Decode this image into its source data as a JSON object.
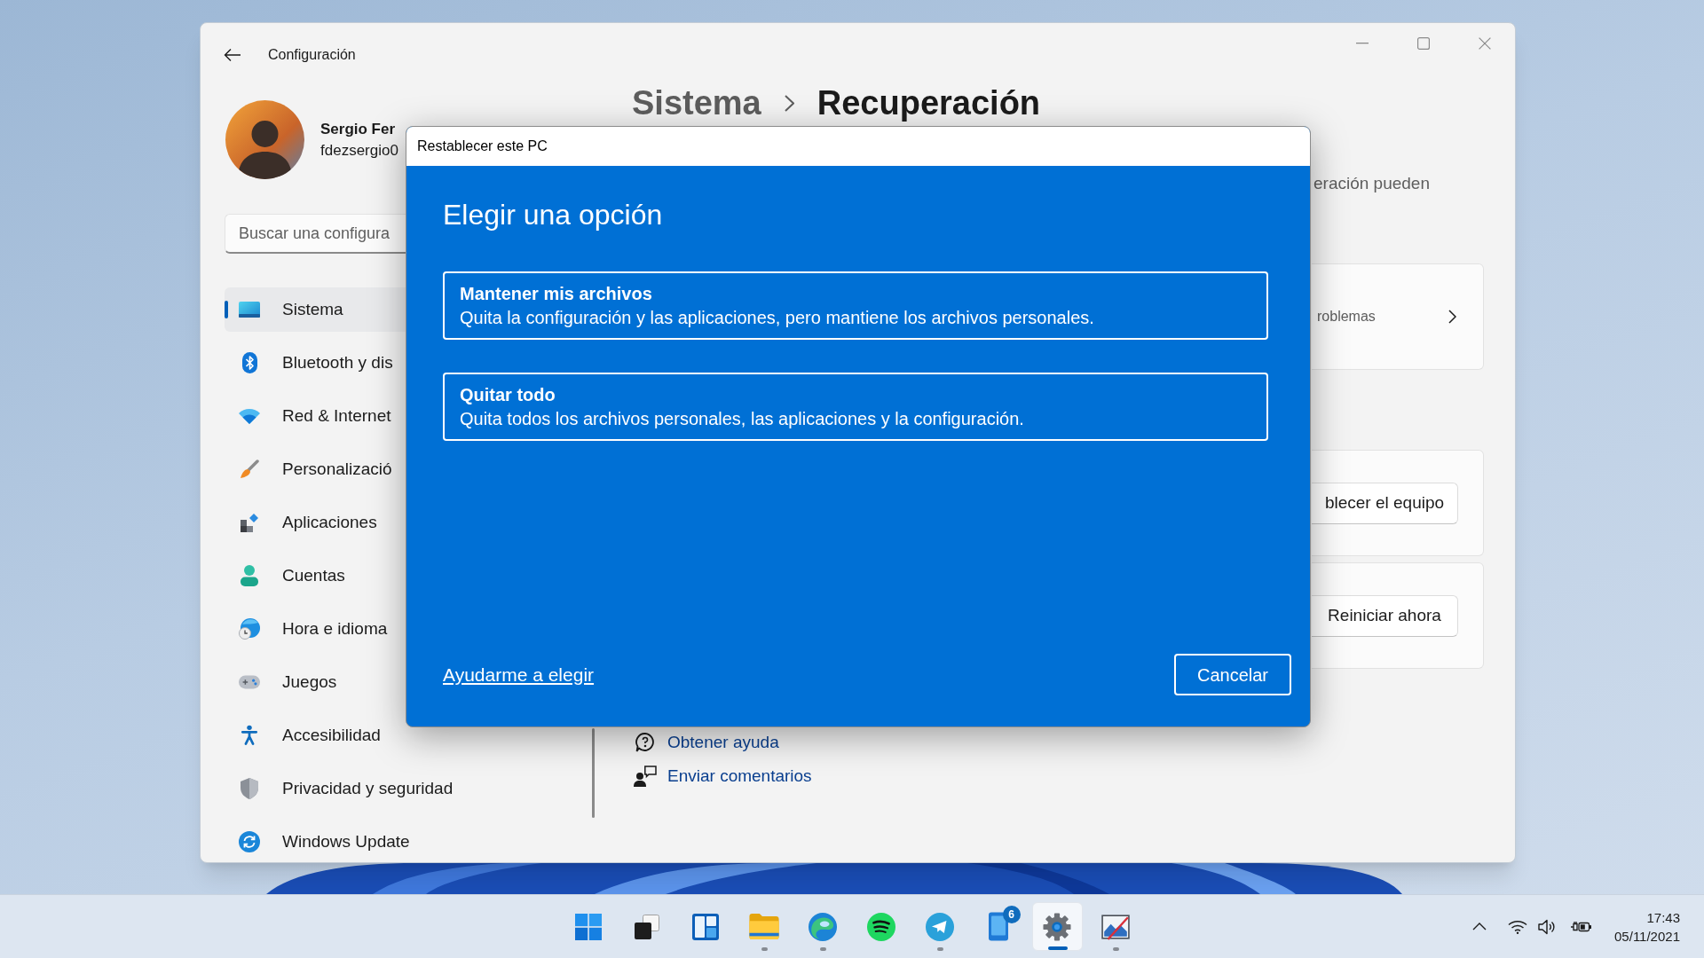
{
  "settings_window": {
    "title": "Configuración",
    "profile": {
      "name": "Sergio Fer",
      "email": "fdezsergio0"
    },
    "search": {
      "placeholder": "Buscar una configura"
    },
    "nav_items": [
      {
        "label": "Sistema",
        "selected": true
      },
      {
        "label": "Bluetooth y dis",
        "selected": false
      },
      {
        "label": "Red & Internet",
        "selected": false
      },
      {
        "label": "Personalizació",
        "selected": false
      },
      {
        "label": "Aplicaciones",
        "selected": false
      },
      {
        "label": "Cuentas",
        "selected": false
      },
      {
        "label": "Hora e idioma",
        "selected": false
      },
      {
        "label": "Juegos",
        "selected": false
      },
      {
        "label": "Accesibilidad",
        "selected": false
      },
      {
        "label": "Privacidad y seguridad",
        "selected": false
      },
      {
        "label": "Windows Update",
        "selected": false
      }
    ],
    "breadcrumb": [
      "Sistema",
      "Recuperación"
    ],
    "description": "eración pueden",
    "cards": [
      {
        "kind": "link",
        "text": "roblemas"
      },
      {
        "kind": "button",
        "text": "blecer el equipo"
      },
      {
        "kind": "button",
        "text": "Reiniciar ahora"
      }
    ],
    "help_links": [
      "Obtener ayuda",
      "Enviar comentarios"
    ]
  },
  "dialog": {
    "title": "Restablecer este PC",
    "heading": "Elegir una opción",
    "options": [
      {
        "title": "Mantener mis archivos",
        "description": "Quita la configuración y las aplicaciones, pero mantiene los archivos personales."
      },
      {
        "title": "Quitar todo",
        "description": "Quita todos los archivos personales, las aplicaciones y la configuración."
      }
    ],
    "link": "Ayudarme a elegir",
    "button": "Cancelar"
  },
  "taskbar": {
    "apps": [
      {
        "kind": "start",
        "running": false,
        "active": false
      },
      {
        "kind": "task_view",
        "running": false,
        "active": false
      },
      {
        "kind": "widgets",
        "running": false,
        "active": false
      },
      {
        "kind": "explorer",
        "running": true,
        "active": false
      },
      {
        "kind": "browser",
        "running": true,
        "active": false
      },
      {
        "kind": "music",
        "running": false,
        "active": false
      },
      {
        "kind": "messenger",
        "running": true,
        "active": false
      },
      {
        "kind": "phone",
        "running": false,
        "active": false,
        "badge": "6"
      },
      {
        "kind": "settings",
        "running": true,
        "active": true
      },
      {
        "kind": "image_editor",
        "running": true,
        "active": false
      }
    ],
    "clock": {
      "time": "17:43",
      "date": "05/11/2021"
    }
  }
}
